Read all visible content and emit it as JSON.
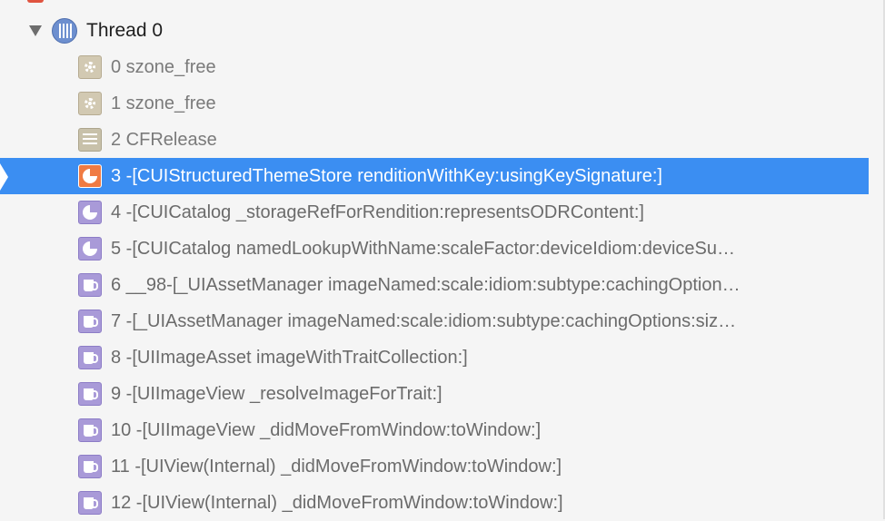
{
  "thread": {
    "label": "Thread 0",
    "expanded": true,
    "icon": "thread-icon"
  },
  "frames": [
    {
      "text": "0 szone_free",
      "icon": "gear-icon"
    },
    {
      "text": "1 szone_free",
      "icon": "gear-icon"
    },
    {
      "text": "2 CFRelease",
      "icon": "table-icon"
    },
    {
      "text": "3 -[CUIStructuredThemeStore renditionWithKey:usingKeySignature:]",
      "icon": "pie-icon",
      "selected": true
    },
    {
      "text": "4 -[CUICatalog _storageRefForRendition:representsODRContent:]",
      "icon": "pie-icon"
    },
    {
      "text": "5 -[CUICatalog namedLookupWithName:scaleFactor:deviceIdiom:deviceSu…",
      "icon": "pie-icon"
    },
    {
      "text": "6 __98-[_UIAssetManager imageNamed:scale:idiom:subtype:cachingOption…",
      "icon": "mug-icon"
    },
    {
      "text": "7 -[_UIAssetManager imageNamed:scale:idiom:subtype:cachingOptions:siz…",
      "icon": "mug-icon"
    },
    {
      "text": "8 -[UIImageAsset imageWithTraitCollection:]",
      "icon": "mug-icon"
    },
    {
      "text": "9 -[UIImageView _resolveImageForTrait:]",
      "icon": "mug-icon"
    },
    {
      "text": "10 -[UIImageView _didMoveFromWindow:toWindow:]",
      "icon": "mug-icon"
    },
    {
      "text": "11 -[UIView(Internal) _didMoveFromWindow:toWindow:]",
      "icon": "mug-icon"
    },
    {
      "text": "12 -[UIView(Internal) _didMoveFromWindow:toWindow:]",
      "icon": "mug-icon"
    }
  ],
  "colors": {
    "selection": "#3b8ef2",
    "background": "#f5f5f5",
    "selected_icon": "#f07b43",
    "uikit_icon": "#a99ad8",
    "system_icon": "#d2c9b2"
  }
}
